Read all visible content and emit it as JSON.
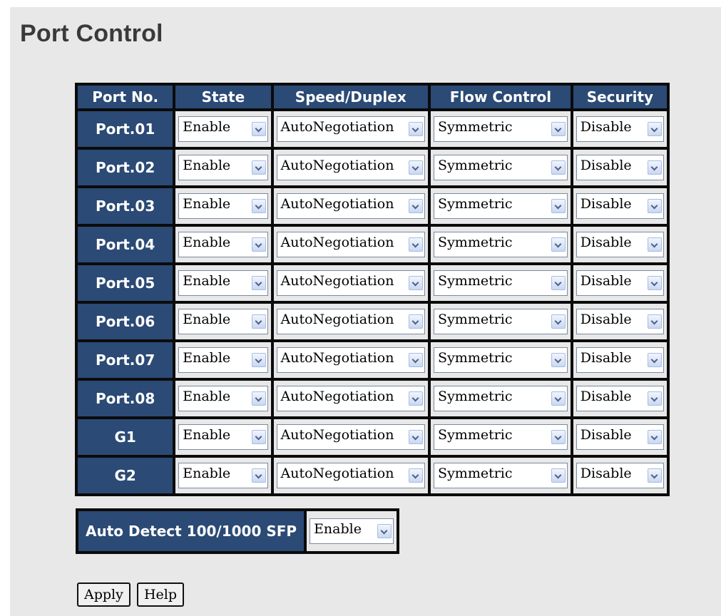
{
  "page": {
    "title": "Port Control"
  },
  "table": {
    "headers": [
      "Port No.",
      "State",
      "Speed/Duplex",
      "Flow Control",
      "Security"
    ],
    "rows": [
      {
        "port": "Port.01",
        "state": "Enable",
        "speed": "AutoNegotiation",
        "flow": "Symmetric",
        "security": "Disable"
      },
      {
        "port": "Port.02",
        "state": "Enable",
        "speed": "AutoNegotiation",
        "flow": "Symmetric",
        "security": "Disable"
      },
      {
        "port": "Port.03",
        "state": "Enable",
        "speed": "AutoNegotiation",
        "flow": "Symmetric",
        "security": "Disable"
      },
      {
        "port": "Port.04",
        "state": "Enable",
        "speed": "AutoNegotiation",
        "flow": "Symmetric",
        "security": "Disable"
      },
      {
        "port": "Port.05",
        "state": "Enable",
        "speed": "AutoNegotiation",
        "flow": "Symmetric",
        "security": "Disable"
      },
      {
        "port": "Port.06",
        "state": "Enable",
        "speed": "AutoNegotiation",
        "flow": "Symmetric",
        "security": "Disable"
      },
      {
        "port": "Port.07",
        "state": "Enable",
        "speed": "AutoNegotiation",
        "flow": "Symmetric",
        "security": "Disable"
      },
      {
        "port": "Port.08",
        "state": "Enable",
        "speed": "AutoNegotiation",
        "flow": "Symmetric",
        "security": "Disable"
      },
      {
        "port": "G1",
        "state": "Enable",
        "speed": "AutoNegotiation",
        "flow": "Symmetric",
        "security": "Disable"
      },
      {
        "port": "G2",
        "state": "Enable",
        "speed": "AutoNegotiation",
        "flow": "Symmetric",
        "security": "Disable"
      }
    ]
  },
  "auto_detect": {
    "label": "Auto Detect 100/1000 SFP",
    "value": "Enable"
  },
  "buttons": {
    "apply": "Apply",
    "help": "Help"
  },
  "icons": {
    "dropdown": "chevron-down-icon"
  },
  "colors": {
    "header_bg": "#2b4a75",
    "border": "#0b0b0b",
    "page_bg": "#e8e8e8"
  }
}
